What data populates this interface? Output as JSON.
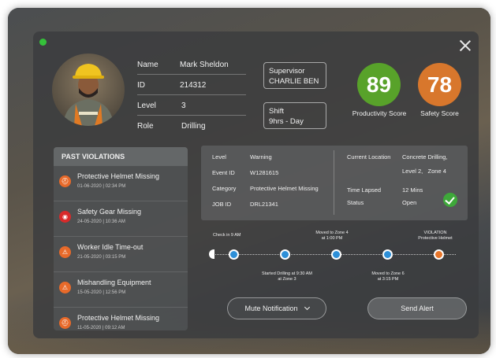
{
  "worker": {
    "name_label": "Name",
    "name": "Mark Sheldon",
    "id_label": "ID",
    "id": "214312",
    "level_label": "Level",
    "level": "3",
    "role_label": "Role",
    "role": "Drilling"
  },
  "supervisor": {
    "label": "Supervisor",
    "name": "CHARLIE BEN"
  },
  "shift": {
    "label": "Shift",
    "value": "9hrs - Day"
  },
  "scores": {
    "productivity": {
      "value": "89",
      "label": "Productivity Score",
      "color": "#58a22a"
    },
    "safety": {
      "value": "78",
      "label": "Safety Score",
      "color": "#d8772c"
    }
  },
  "violations": {
    "title": "PAST VIOLATIONS",
    "items": [
      {
        "title": "Protective Helmet Missing",
        "date": "01-06-2020 | 02:34 PM",
        "icon": "helmet-icon",
        "color": "#e86a2a"
      },
      {
        "title": "Safety Gear Missing",
        "date": "24-05-2020 | 10:36 AM",
        "icon": "goggles-icon",
        "color": "#d82a2a"
      },
      {
        "title": "Worker Idle Time-out",
        "date": "21-05-2020 | 03:15 PM",
        "icon": "warning-icon",
        "color": "#e86a2a"
      },
      {
        "title": "Mishandling Equipment",
        "date": "15-05-2020 | 12:56 PM",
        "icon": "warning-icon",
        "color": "#e86a2a"
      },
      {
        "title": "Protective Helmet Missing",
        "date": "11-05-2020 | 09:12 AM",
        "icon": "helmet-icon",
        "color": "#e86a2a"
      }
    ]
  },
  "incident": {
    "level_label": "Level",
    "level": "Warning",
    "event_label": "Event ID",
    "event": "W1281615",
    "category_label": "Category",
    "category": "Protective Helmet Missing",
    "job_label": "JOB ID",
    "job": "DRL21341",
    "location_label": "Current Location",
    "location_line1": "Concrete Drilling,",
    "location_line2": "Level 2,   Zone 4",
    "time_label": "Time Lapsed",
    "time": "12 Mins",
    "status_label": "Status",
    "status": "Open"
  },
  "timeline": {
    "check_in": "Check in 9 AM",
    "zone4_line1": "Moved to Zone 4",
    "zone4_line2": "at 1:00 PM",
    "violation_line1": "VIOLATION",
    "violation_line2": "Protective Helmet",
    "drilling_line1": "Started Drilling at 9:30 AM",
    "drilling_line2": "at Zone 3",
    "zone6_line1": "Moved to Zone 6",
    "zone6_line2": "at 3:15 PM",
    "dot_color": "#2d8fd8",
    "violation_color": "#e8762a"
  },
  "actions": {
    "mute": "Mute Notification",
    "send": "Send Alert"
  }
}
